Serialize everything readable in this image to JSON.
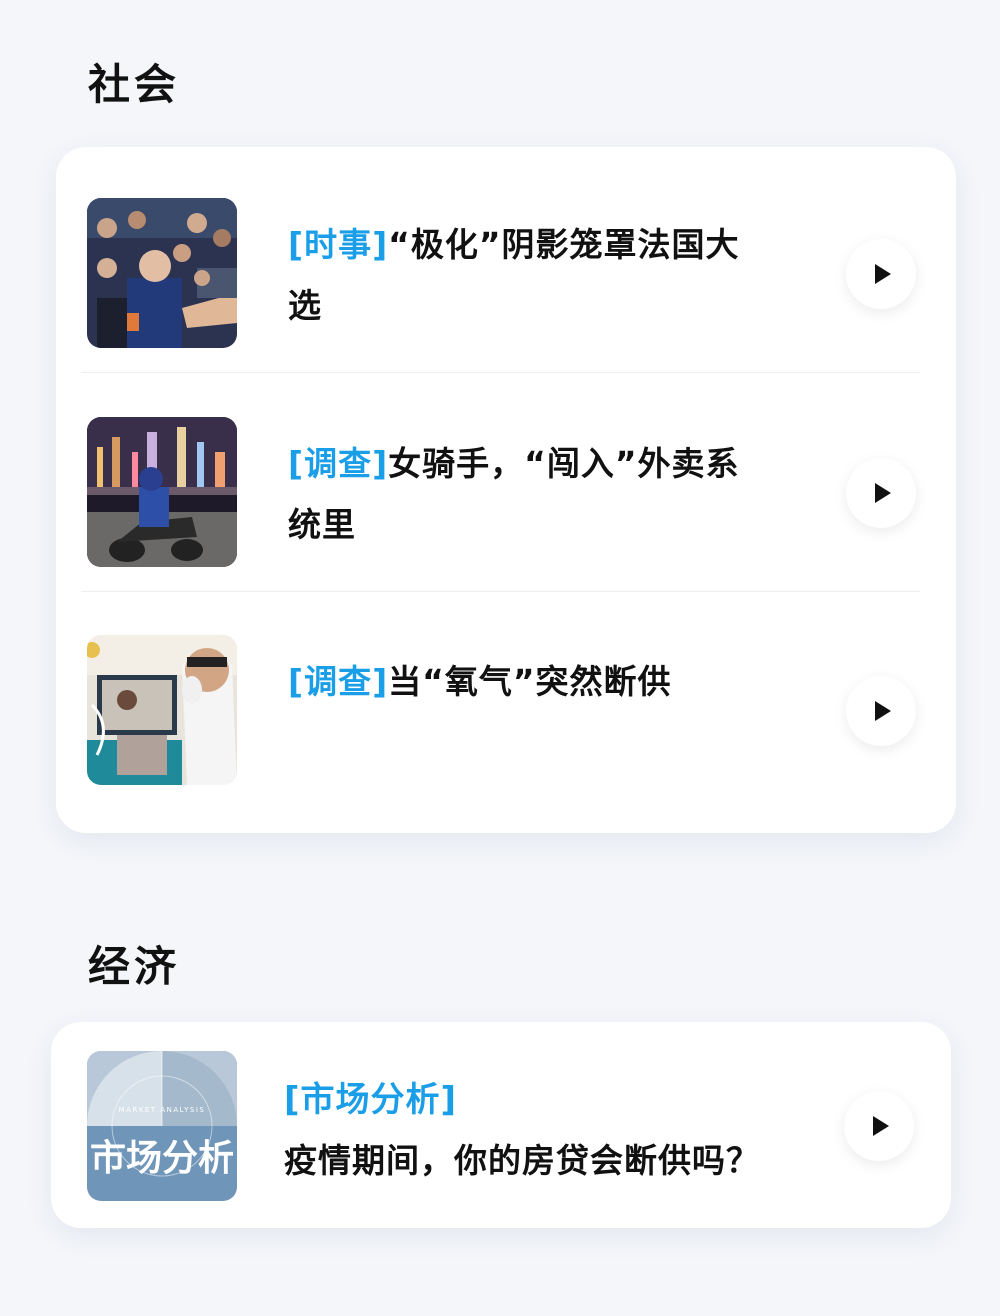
{
  "sections": [
    {
      "title": "社会",
      "items": [
        {
          "tag": "[时事]",
          "title": "“极化”阴影笼罩法国大选",
          "thumb_icon": "photo-crowd-icon"
        },
        {
          "tag": "[调查]",
          "title": "女骑手，“闯入”外卖系统里",
          "thumb_icon": "photo-rider-night-icon"
        },
        {
          "tag": "[调查]",
          "title": "当“氧气”突然断供",
          "thumb_icon": "photo-oxygen-icon"
        }
      ]
    },
    {
      "title": "经济",
      "items": [
        {
          "tag": "[市场分析]",
          "title": "疫情期间，你的房贷会断供吗？",
          "thumb_caption_small": "MARKET ANALYSIS",
          "thumb_caption_large": "市场分析"
        }
      ]
    }
  ],
  "colors": {
    "accent": "#1a9ee8",
    "background": "#f4f6fa",
    "text": "#111111"
  },
  "icons": {
    "play": "play-icon"
  }
}
